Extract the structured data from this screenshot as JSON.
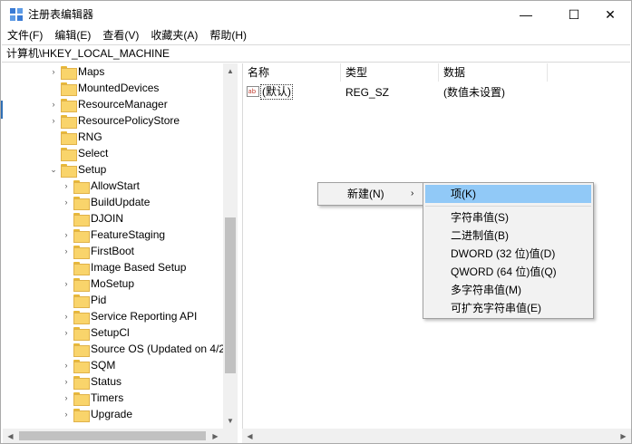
{
  "window": {
    "title": "注册表编辑器",
    "controls": {
      "minimize": "—",
      "maximize": "☐",
      "close": "✕"
    }
  },
  "menu": [
    "文件(F)",
    "编辑(E)",
    "查看(V)",
    "收藏夹(A)",
    "帮助(H)"
  ],
  "address": "计算机\\HKEY_LOCAL_MACHINE",
  "tree": {
    "items": [
      {
        "label": "Maps",
        "expander": "›"
      },
      {
        "label": "MountedDevices",
        "expander": ""
      },
      {
        "label": "ResourceManager",
        "expander": "›"
      },
      {
        "label": "ResourcePolicyStore",
        "expander": "›"
      },
      {
        "label": "RNG",
        "expander": ""
      },
      {
        "label": "Select",
        "expander": ""
      },
      {
        "label": "Setup",
        "expander": "⌄"
      },
      {
        "label": "AllowStart",
        "expander": "›"
      },
      {
        "label": "BuildUpdate",
        "expander": "›"
      },
      {
        "label": "DJOIN",
        "expander": ""
      },
      {
        "label": "FeatureStaging",
        "expander": "›"
      },
      {
        "label": "FirstBoot",
        "expander": "›"
      },
      {
        "label": "Image Based Setup",
        "expander": ""
      },
      {
        "label": "MoSetup",
        "expander": "›"
      },
      {
        "label": "Pid",
        "expander": ""
      },
      {
        "label": "Service Reporting API",
        "expander": "›"
      },
      {
        "label": "SetupCl",
        "expander": "›"
      },
      {
        "label": "Source OS (Updated on 4/2",
        "expander": ""
      },
      {
        "label": "SQM",
        "expander": "›"
      },
      {
        "label": "Status",
        "expander": "›"
      },
      {
        "label": "Timers",
        "expander": "›"
      },
      {
        "label": "Upgrade",
        "expander": "›"
      }
    ]
  },
  "list": {
    "columns": [
      "名称",
      "类型",
      "数据"
    ],
    "rows": [
      {
        "name": "(默认)",
        "type": "REG_SZ",
        "data": "(数值未设置)",
        "icon": "ab-string-icon"
      }
    ]
  },
  "context_menu": {
    "main_item": "新建(N)",
    "submenu_arrow": "›",
    "submenu": [
      "项(K)",
      "字符串值(S)",
      "二进制值(B)",
      "DWORD (32 位)值(D)",
      "QWORD (64 位)值(Q)",
      "多字符串值(M)",
      "可扩充字符串值(E)"
    ]
  },
  "scroll": {
    "up": "▲",
    "down": "▼",
    "left": "◀",
    "right": "▶"
  },
  "colors": {
    "highlight": "#91c9f7",
    "menu_bg": "#f2f2f2",
    "folder": "#f9d46b"
  }
}
